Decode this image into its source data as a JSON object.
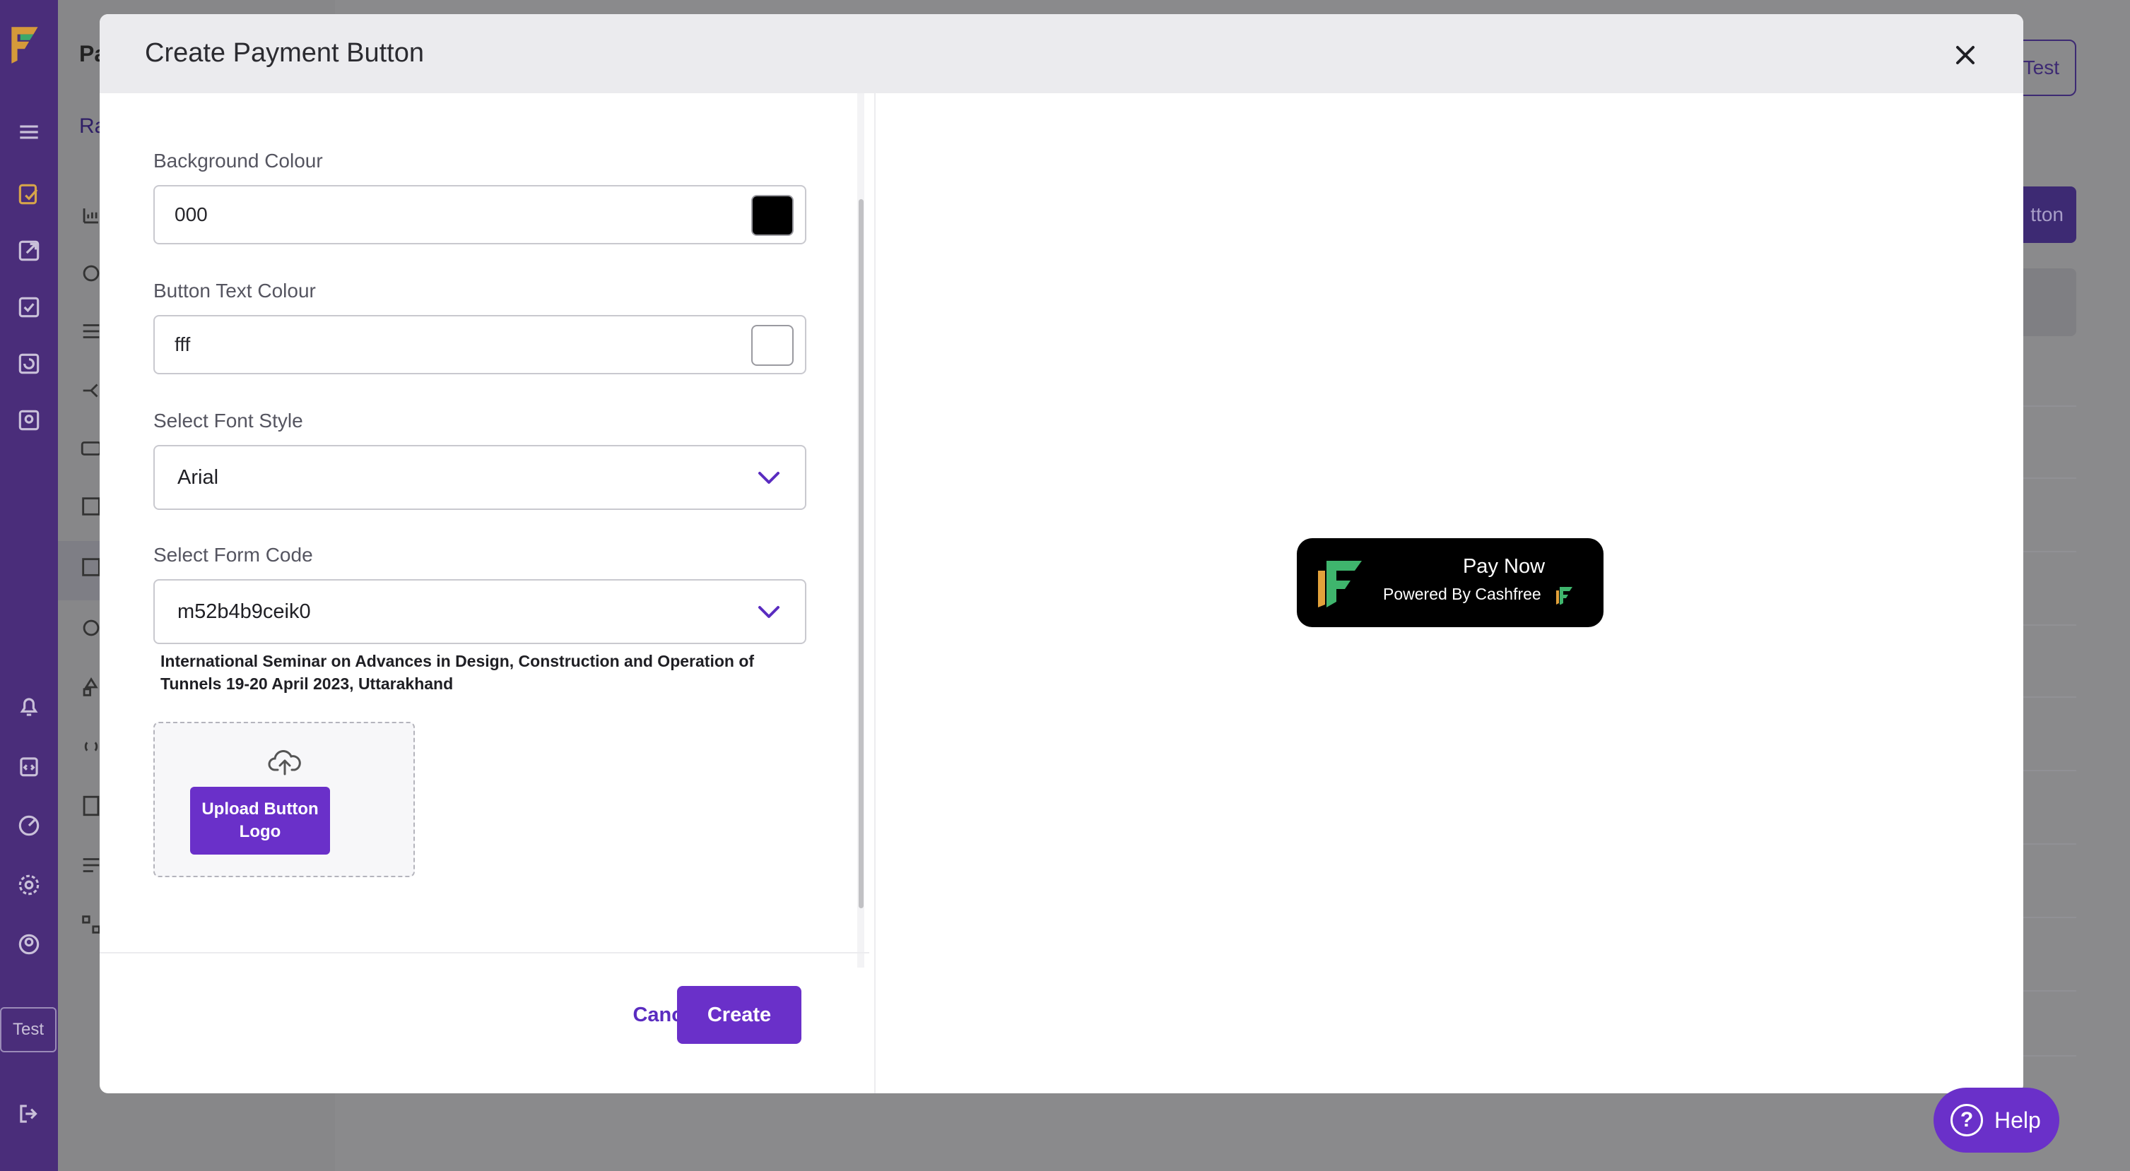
{
  "app": {
    "panel_title": "Pa",
    "panel_subtitle": "Ra",
    "rail_test_label": "Test",
    "bg_test_button": "Test",
    "bg_create_button": "tton"
  },
  "modal": {
    "title": "Create Payment Button",
    "fields": {
      "background_colour": {
        "label": "Background Colour",
        "value": "000",
        "swatch": "#000000"
      },
      "button_text_colour": {
        "label": "Button Text Colour",
        "value": "fff",
        "swatch": "#ffffff"
      },
      "font_style": {
        "label": "Select Font Style",
        "value": "Arial"
      },
      "form_code": {
        "label": "Select Form Code",
        "value": "m52b4b9ceik0",
        "description": "International Seminar on Advances in Design, Construction and Operation of Tunnels 19-20 April 2023, Uttarakhand"
      }
    },
    "upload_button": "Upload Button Logo",
    "cancel": "Cancel",
    "create": "Create",
    "preview": {
      "title": "Pay Now",
      "subtitle": "Powered By Cashfree"
    }
  },
  "help": {
    "label": "Help"
  },
  "colors": {
    "accent": "#6a30c9",
    "rail": "#4a2d7a"
  }
}
